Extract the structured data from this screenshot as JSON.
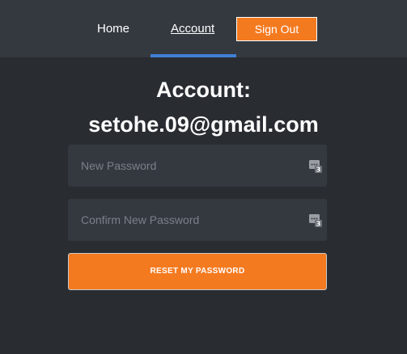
{
  "nav": {
    "home_label": "Home",
    "account_label": "Account",
    "signout_label": "Sign Out"
  },
  "page": {
    "title_line1": "Account:",
    "title_line2": "setohe.09@gmail.com"
  },
  "form": {
    "new_password_placeholder": "New Password",
    "confirm_password_placeholder": "Confirm New Password",
    "new_password_value": "",
    "confirm_password_value": "",
    "submit_label": "RESET MY PASSWORD"
  },
  "icons": {
    "password_manager": "password-manager-icon"
  },
  "colors": {
    "background": "#292d32",
    "navbar": "#343940",
    "accent": "#f47a20",
    "active_tab": "#3f7fd6",
    "field_background": "#343940"
  }
}
